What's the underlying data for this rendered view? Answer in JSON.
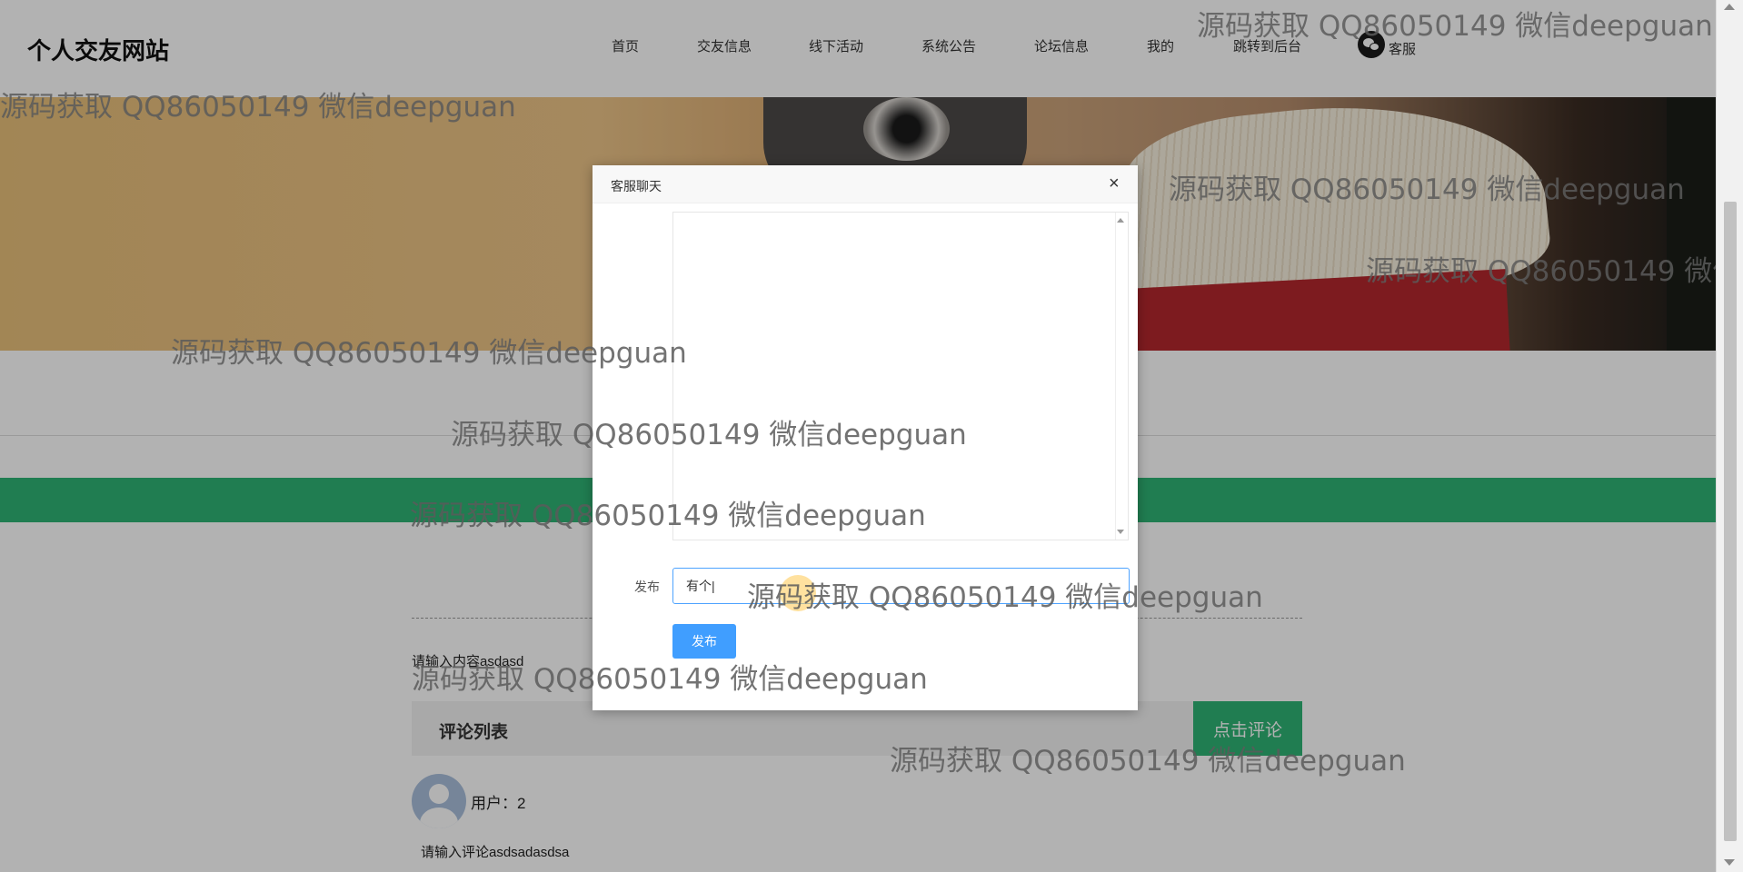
{
  "site": {
    "logo": "个人交友网站"
  },
  "nav": {
    "items": [
      {
        "label": "首页"
      },
      {
        "label": "交友信息"
      },
      {
        "label": "线下活动"
      },
      {
        "label": "系统公告"
      },
      {
        "label": "论坛信息"
      },
      {
        "label": "我的"
      },
      {
        "label": "跳转到后台"
      }
    ],
    "customer_service": "客服"
  },
  "post": {
    "content": "请输入内容asdasd"
  },
  "comments": {
    "title": "评论列表",
    "button": "点击评论",
    "items": [
      {
        "user": "用户：2",
        "text": "请输入评论asdsadasdsa"
      }
    ]
  },
  "dialog": {
    "title": "客服聊天",
    "close": "×",
    "publish_label": "发布",
    "input_value": "有个|",
    "publish_button": "发布"
  },
  "watermark": {
    "text": "源码获取 QQ86050149 微信deepguan"
  },
  "colors": {
    "green": "#2fb374",
    "primary_blue": "#409eff",
    "overlay": "rgba(0,0,0,0.3)"
  }
}
